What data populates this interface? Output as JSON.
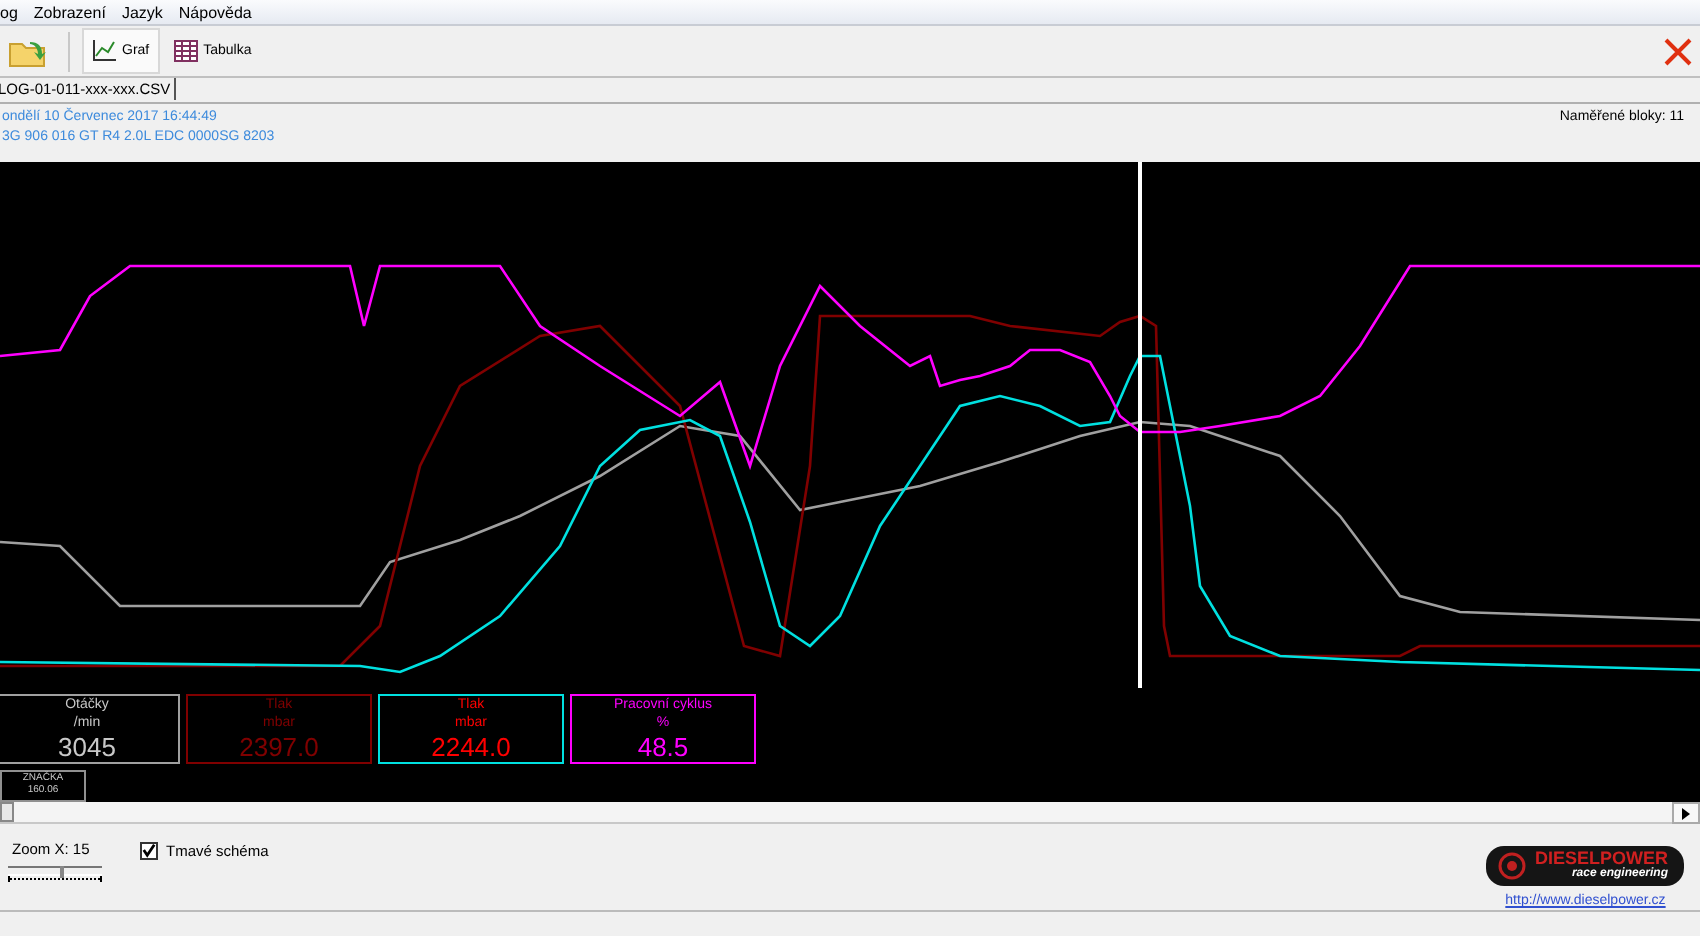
{
  "menu": [
    "og",
    "Zobrazení",
    "Jazyk",
    "Nápověda"
  ],
  "toolbar": [
    {
      "label": "Graf",
      "kind": "chart",
      "selected": true
    },
    {
      "label": "Tabulka",
      "kind": "table",
      "selected": false
    }
  ],
  "file_tab": {
    "label": "LOG-01-011-xxx-xxx.CSV"
  },
  "info": {
    "date": "ondělí 10 Červenec 2017 16:44:49",
    "engine": "3G 906 016 GT  R4 2.0L EDC 0000SG  8203",
    "blocks": "Naměřené bloky: 11"
  },
  "gauges": [
    {
      "color": "#a0a0a0",
      "reading": {
        "label": "Otáčky",
        "unit": "/min",
        "value": "3045",
        "color": "#c8c8c8"
      }
    },
    {
      "color": "#800000",
      "reading": {
        "label": "Tlak",
        "unit": "mbar",
        "value": "2397.0",
        "color": "#800000"
      }
    },
    {
      "color": "#00e0e0",
      "reading": {
        "label": "Tlak",
        "unit": "mbar",
        "value": "2244.0",
        "color": "#ff0000"
      }
    },
    {
      "color": "#ff00ff",
      "reading": {
        "label": "Pracovní cyklus",
        "unit": "%",
        "value": "48.5",
        "color": "#ff00ff"
      }
    }
  ],
  "marker": {
    "label": "ZNAČKA",
    "value": "160.06"
  },
  "zoom": {
    "label": "Zoom X: 15",
    "level": 0.55
  },
  "dark_scheme": {
    "label": "Tmavé schéma",
    "checked": true
  },
  "logo": {
    "title": "DIESELPOWER",
    "subtitle": "race engineering"
  },
  "link": "http://www.dieselpower.cz"
}
